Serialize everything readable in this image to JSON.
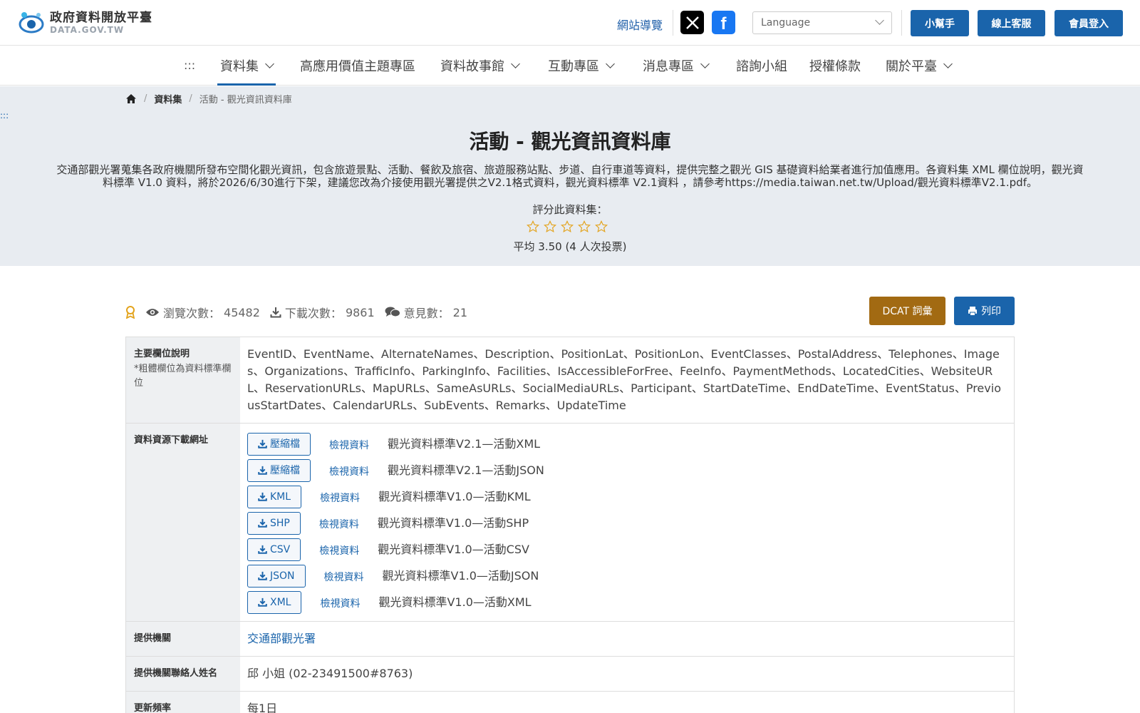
{
  "header": {
    "logo_zh": "政府資料開放平臺",
    "logo_en": "DATA.GOV.TW",
    "sitemap": "網站導覽",
    "language_placeholder": "Language",
    "buttons": {
      "helper": "小幫手",
      "support": "線上客服",
      "login": "會員登入"
    }
  },
  "nav": {
    "accesskey": ":::",
    "items": [
      "資料集",
      "高應用價值主題專區",
      "資料故事館",
      "互動專區",
      "消息專區",
      "諮詢小組",
      "授權條款",
      "關於平臺"
    ]
  },
  "breadcrumb": {
    "level1": "資料集",
    "current": "活動 - 觀光資訊資料庫"
  },
  "accesskey_c": ":::",
  "dataset": {
    "title": "活動 - 觀光資訊資料庫",
    "description": "交通部觀光署蒐集各政府機關所發布空間化觀光資訊，包含旅遊景點、活動、餐飲及旅宿、旅遊服務站點、步道、自行車道等資料，提供完整之觀光 GIS 基礎資料給業者進行加值應用。各資料集 XML 欄位說明，觀光資料標準 V1.0 資料，將於2026/6/30進行下架，建議您改為介接使用觀光署提供之V2.1格式資料，觀光資料標準 V2.1資料 ，請參考https://media.taiwan.net.tw/Upload/觀光資料標準V2.1.pdf。",
    "rate_label": "評分此資料集：",
    "rating_avg": 3.5,
    "avg_text": "平均 3.50 (4 人次投票)"
  },
  "stats": {
    "views_label": "瀏覽次數：",
    "views": "45482",
    "downloads_label": "下載次數：",
    "downloads": "9861",
    "comments_label": "意見數：",
    "comments": "21"
  },
  "actions": {
    "dcat": "DCAT 詞彙",
    "print": "列印"
  },
  "meta": {
    "fields_label": "主要欄位說明",
    "fields_note": "*粗體欄位為資料標準欄位",
    "fields": "EventID、EventName、AlternateNames、Description、PositionLat、PositionLon、EventClasses、PostalAddress、Telephones、Images、Organizations、TrafficInfo、ParkingInfo、Facilities、IsAccessibleForFree、FeeInfo、PaymentMethods、LocatedCities、WebsiteURL、ReservationURLs、MapURLs、SameAsURLs、SocialMediaURLs、Participant、StartDateTime、EndDateTime、EventStatus、PreviousStartDates、CalendarURLs、SubEvents、Remarks、UpdateTime",
    "resources_label": "資料資源下載網址",
    "view_label": "檢視資料",
    "resources": [
      {
        "format": "壓縮檔",
        "name": "觀光資料標準V2.1—活動XML"
      },
      {
        "format": "壓縮檔",
        "name": "觀光資料標準V2.1—活動JSON"
      },
      {
        "format": "KML",
        "name": "觀光資料標準V1.0—活動KML"
      },
      {
        "format": "SHP",
        "name": "觀光資料標準V1.0—活動SHP"
      },
      {
        "format": "CSV",
        "name": "觀光資料標準V1.0—活動CSV"
      },
      {
        "format": "JSON",
        "name": "觀光資料標準V1.0—活動JSON"
      },
      {
        "format": "XML",
        "name": "觀光資料標準V1.0—活動XML"
      }
    ],
    "agency_label": "提供機關",
    "agency": "交通部觀光署",
    "contact_label": "提供機關聯絡人姓名",
    "contact": "邱 小姐 (02-23491500#8763)",
    "frequency_label": "更新頻率",
    "frequency": "每1日"
  },
  "colors": {
    "primary": "#1a64ab",
    "dcat": "#a26a12",
    "hero_bg": "#e8ecf1",
    "star": "#e3a31c"
  }
}
